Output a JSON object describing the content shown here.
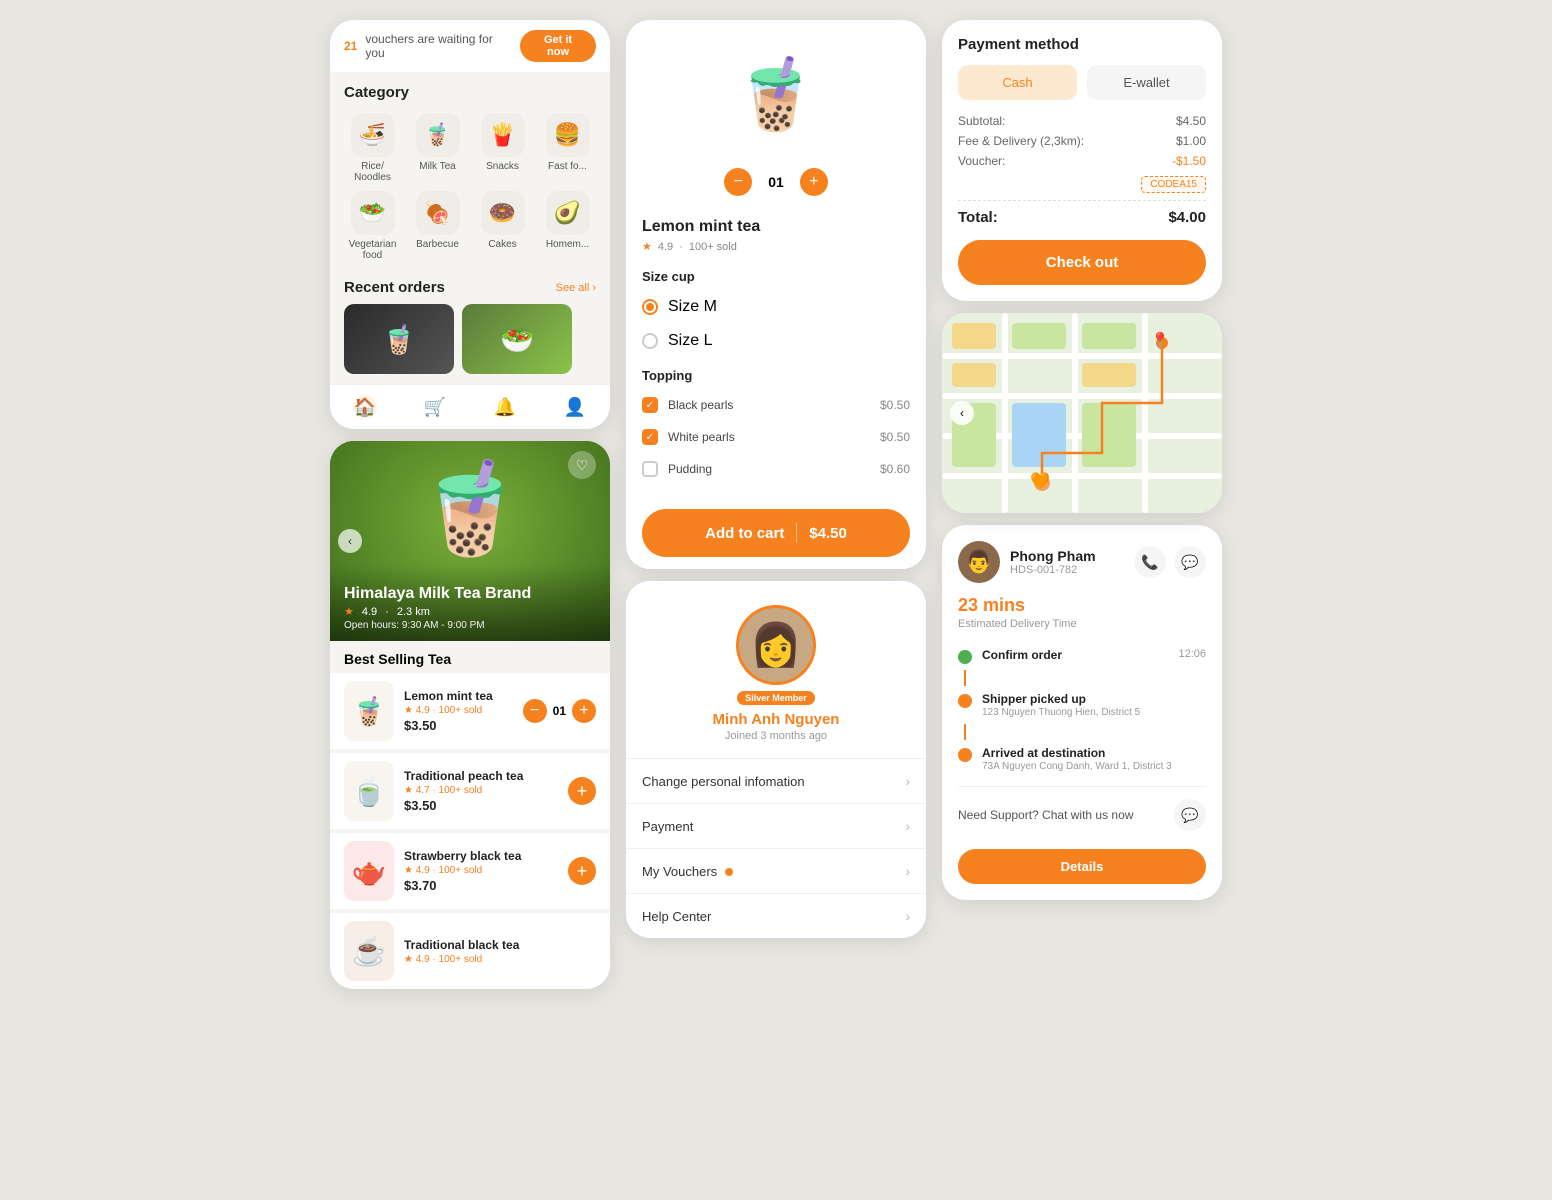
{
  "voucher": {
    "count": "21",
    "text": "vouchers are waiting for you",
    "btn_label": "Get it now"
  },
  "category": {
    "title": "Category",
    "items": [
      {
        "icon": "🍜",
        "label": "Rice/ Noodles"
      },
      {
        "icon": "🧋",
        "label": "Milk Tea"
      },
      {
        "icon": "🍟",
        "label": "Snacks"
      },
      {
        "icon": "🍔",
        "label": "Fast fo..."
      },
      {
        "icon": "🥗",
        "label": "Vegetarian food"
      },
      {
        "icon": "🍖",
        "label": "Barbecue"
      },
      {
        "icon": "🍩",
        "label": "Cakes"
      },
      {
        "icon": "🥑",
        "label": "Homem..."
      }
    ]
  },
  "recent_orders": {
    "title": "Recent orders",
    "see_all": "See all ›"
  },
  "banner": {
    "brand": "Himalaya Milk Tea Brand",
    "rating": "4.9",
    "distance": "2.3 km",
    "hours": "Open hours: 9:30 AM - 9:00 PM"
  },
  "best_selling": {
    "title": "Best Selling Tea",
    "items": [
      {
        "icon": "🧋",
        "name": "Lemon mint tea",
        "rating": "4.9",
        "sold": "100+ sold",
        "price": "$3.50",
        "qty": "01"
      },
      {
        "icon": "🍵",
        "name": "Traditional peach tea",
        "rating": "4.7",
        "sold": "100+ sold",
        "price": "$3.50"
      },
      {
        "icon": "🫖",
        "name": "Strawberry black tea",
        "rating": "4.9",
        "sold": "100+ sold",
        "price": "$3.70"
      },
      {
        "icon": "☕",
        "name": "Traditional black tea",
        "rating": "4.9",
        "sold": "100+ sold",
        "price": "$3.50"
      }
    ]
  },
  "product": {
    "name": "Lemon mint tea",
    "rating": "4.9",
    "sold": "100+ sold",
    "qty": "01",
    "size_label": "Size cup",
    "sizes": [
      {
        "label": "Size M",
        "selected": true
      },
      {
        "label": "Size L",
        "selected": false
      }
    ],
    "topping_label": "Topping",
    "toppings": [
      {
        "name": "Black pearls",
        "price": "$0.50",
        "checked": true
      },
      {
        "name": "White pearls",
        "price": "$0.50",
        "checked": true
      },
      {
        "name": "Pudding",
        "price": "$0.60",
        "checked": false
      }
    ],
    "add_cart_label": "Add to cart",
    "add_cart_price": "$4.50"
  },
  "profile": {
    "avatar_emoji": "👩",
    "member_badge": "Silver Member",
    "name": "Minh Anh Nguyen",
    "joined": "Joined 3 months ago",
    "menu_items": [
      {
        "label": "Change personal infomation",
        "has_badge": false
      },
      {
        "label": "Payment",
        "has_badge": false
      },
      {
        "label": "My Vouchers",
        "has_badge": true
      },
      {
        "label": "Help Center",
        "has_badge": false
      }
    ]
  },
  "payment": {
    "title": "Payment method",
    "methods": [
      {
        "label": "Cash",
        "selected": true
      },
      {
        "label": "E-wallet",
        "selected": false
      }
    ],
    "subtotal_label": "Subtotal:",
    "subtotal_value": "$4.50",
    "delivery_label": "Fee & Delivery (2,3km):",
    "delivery_value": "$1.00",
    "voucher_label": "Voucher:",
    "voucher_value": "-$1.50",
    "voucher_code": "CODEA15",
    "total_label": "Total:",
    "total_value": "$4.00",
    "checkout_label": "Check out"
  },
  "delivery": {
    "driver_emoji": "👨",
    "driver_name": "Phong Pham",
    "driver_id": "HDS-001-782",
    "eta": "23 mins",
    "eta_sub": "Estimated Delivery Time",
    "timeline": [
      {
        "label": "Confirm order",
        "addr": "",
        "time": "12:06",
        "dot": "green"
      },
      {
        "label": "Shipper picked up",
        "addr": "123 Nguyen Thuong Hien, District 5",
        "time": "",
        "dot": "orange"
      },
      {
        "label": "Arrived at destination",
        "addr": "73A Nguyen Cong Danh, Ward 1, District 3",
        "time": "",
        "dot": "orange"
      }
    ],
    "support_text": "Need Support? Chat with us now",
    "details_label": "Details"
  },
  "nav": {
    "icons": [
      "🏠",
      "🛒",
      "🔔",
      "👤"
    ]
  }
}
